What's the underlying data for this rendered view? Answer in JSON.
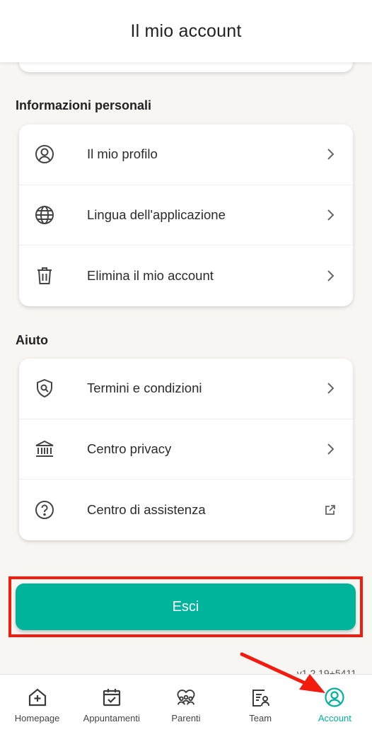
{
  "header": {
    "title": "Il mio account"
  },
  "sections": [
    {
      "title": "Informazioni personali",
      "items": [
        {
          "label": "Il mio profilo",
          "icon": "user-circle-icon",
          "trail": "chevron-right-icon"
        },
        {
          "label": "Lingua dell'applicazione",
          "icon": "globe-icon",
          "trail": "chevron-right-icon"
        },
        {
          "label": "Elimina il mio account",
          "icon": "trash-icon",
          "trail": "chevron-right-icon"
        }
      ]
    },
    {
      "title": "Aiuto",
      "items": [
        {
          "label": "Termini e condizioni",
          "icon": "shield-search-icon",
          "trail": "chevron-right-icon"
        },
        {
          "label": "Centro privacy",
          "icon": "bank-icon",
          "trail": "chevron-right-icon"
        },
        {
          "label": "Centro di assistenza",
          "icon": "question-circle-icon",
          "trail": "external-link-icon"
        }
      ]
    }
  ],
  "logout": {
    "label": "Esci",
    "highlight_color": "#f21b0e"
  },
  "version": "v1.2.19+5411",
  "bottom_nav": {
    "items": [
      {
        "label": "Homepage",
        "icon": "home-plus-icon"
      },
      {
        "label": "Appuntamenti",
        "icon": "calendar-check-icon"
      },
      {
        "label": "Parenti",
        "icon": "family-icon"
      },
      {
        "label": "Team",
        "icon": "team-badge-icon"
      },
      {
        "label": "Account",
        "icon": "account-icon",
        "active": true
      }
    ]
  },
  "colors": {
    "accent": "#00b39b",
    "background": "#f8f6f3",
    "annotation": "#f21b0e"
  }
}
